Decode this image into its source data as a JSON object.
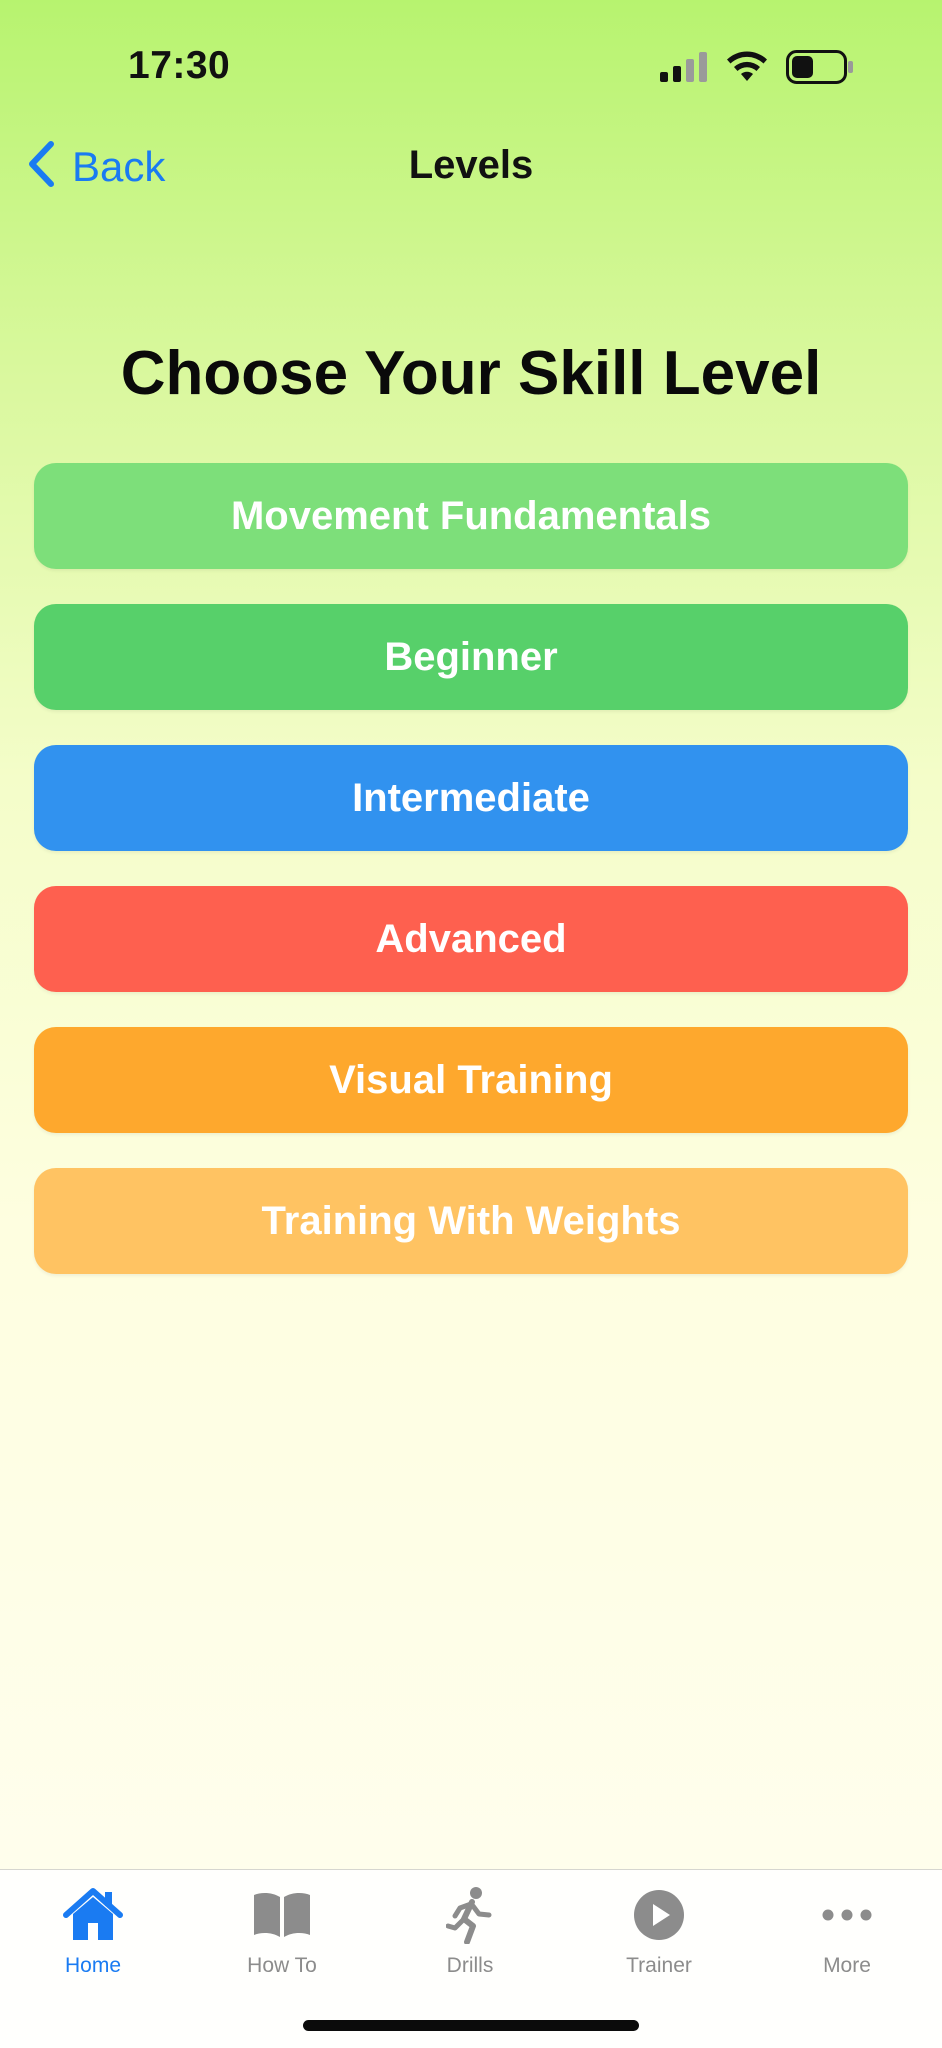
{
  "status_bar": {
    "time": "17:30"
  },
  "nav": {
    "back_label": "Back",
    "title": "Levels"
  },
  "heading": "Choose Your Skill Level",
  "levels": [
    {
      "label": "Movement Fundamentals",
      "color": "#7ddf7a"
    },
    {
      "label": "Beginner",
      "color": "#57d06a"
    },
    {
      "label": "Intermediate",
      "color": "#3192ef"
    },
    {
      "label": "Advanced",
      "color": "#fe604f"
    },
    {
      "label": "Visual Training",
      "color": "#fea82d"
    },
    {
      "label": "Training With Weights",
      "color": "#ffc362"
    }
  ],
  "tab_bar": {
    "active_color": "#1a7bf2",
    "inactive_color": "#8c8c8c",
    "tabs": [
      {
        "label": "Home",
        "icon": "house-icon",
        "active": true
      },
      {
        "label": "How To",
        "icon": "book-icon",
        "active": false
      },
      {
        "label": "Drills",
        "icon": "running-figure-icon",
        "active": false
      },
      {
        "label": "Trainer",
        "icon": "play-circle-icon",
        "active": false
      },
      {
        "label": "More",
        "icon": "ellipsis-icon",
        "active": false
      }
    ]
  }
}
